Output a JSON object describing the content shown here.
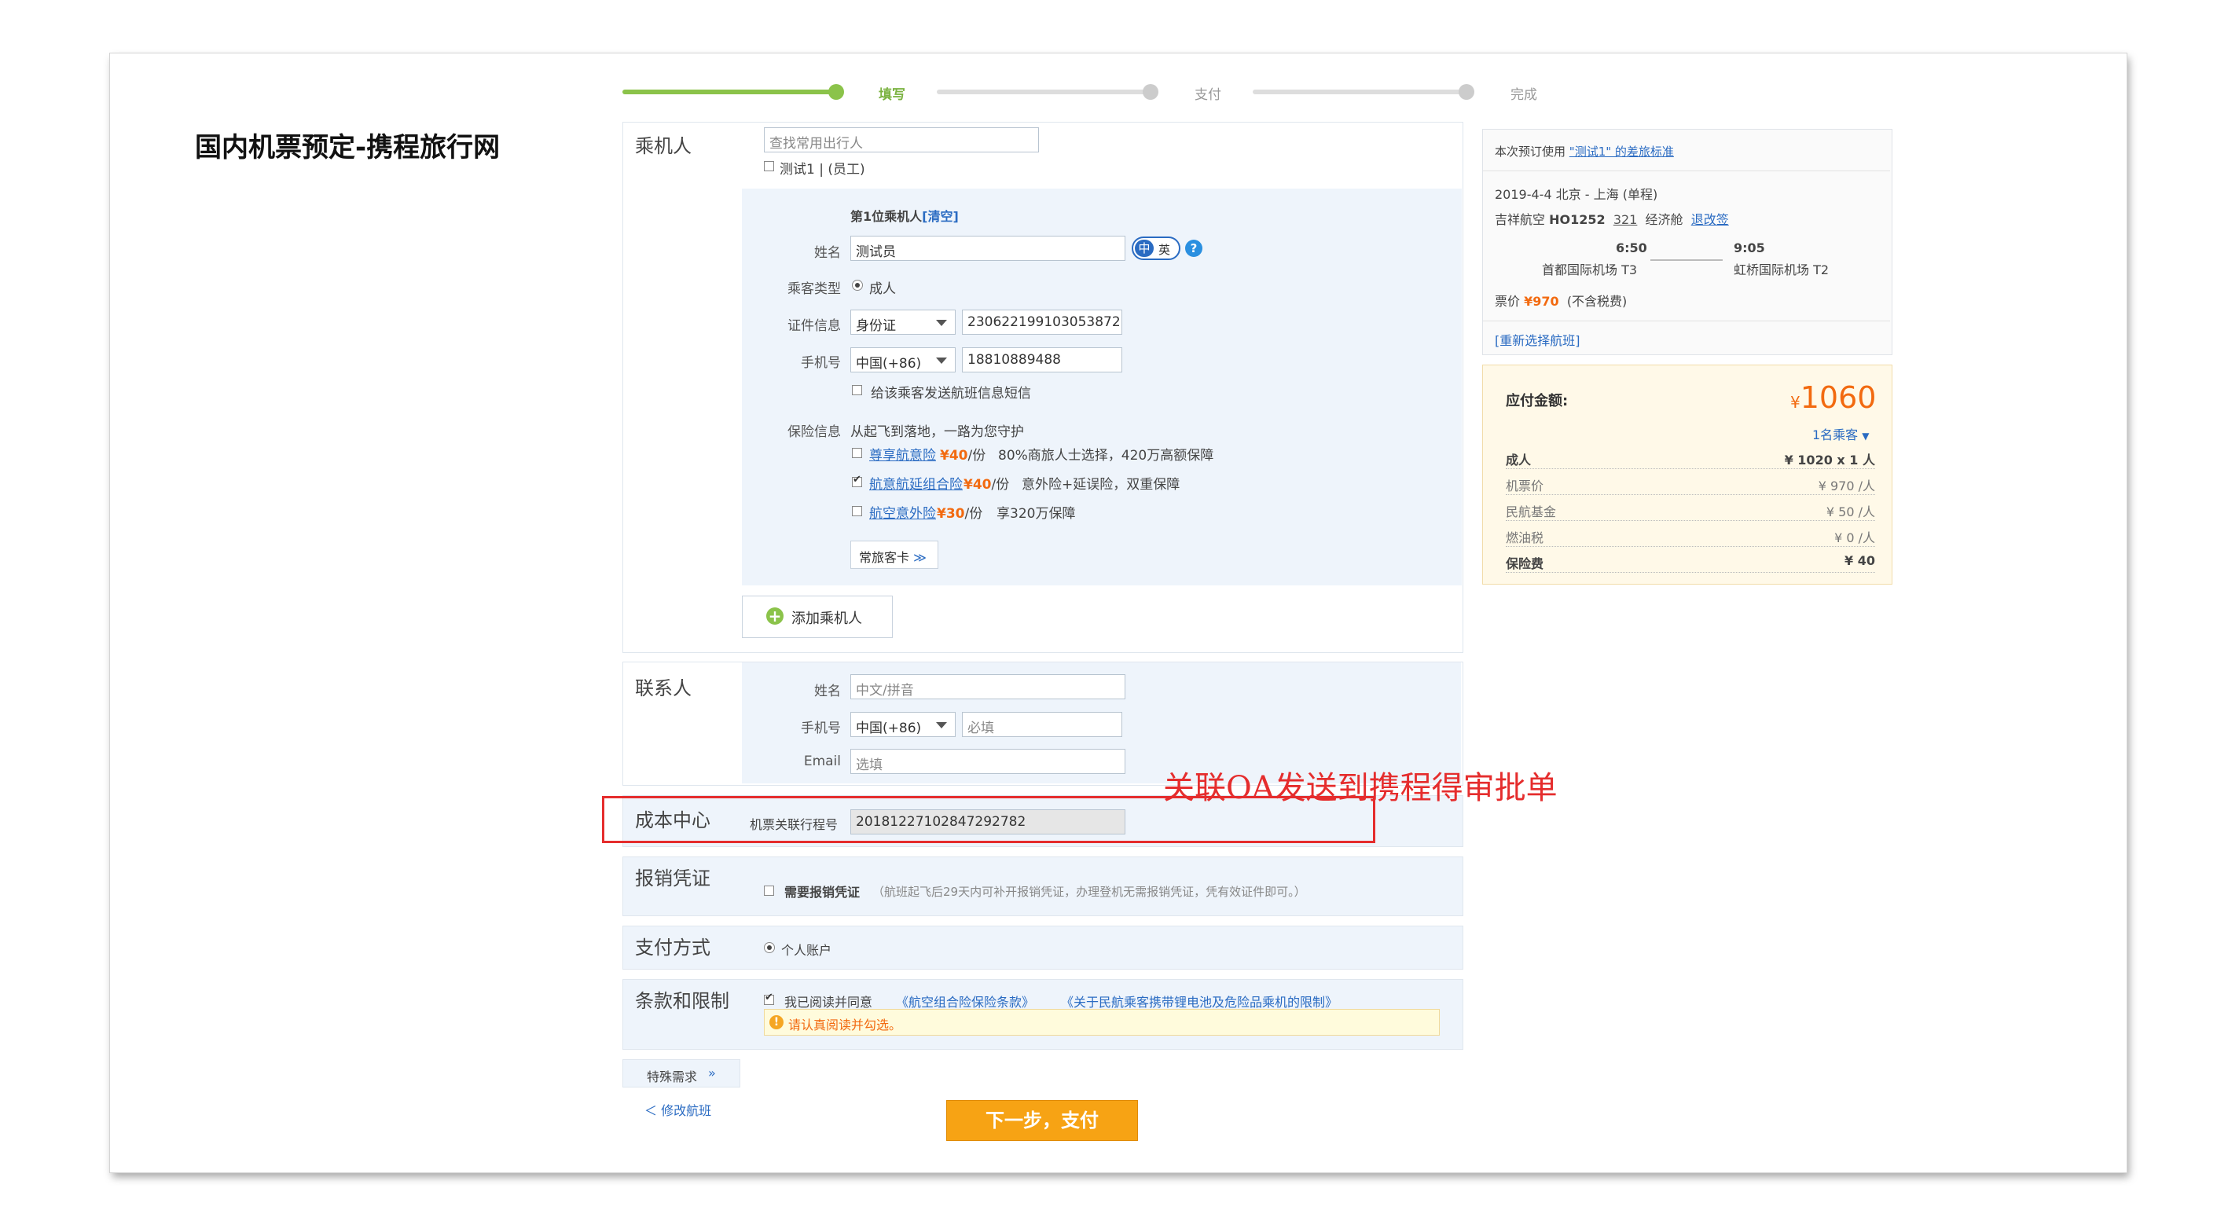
{
  "page_title": "国内机票预定-携程旅行网",
  "progress": {
    "steps": [
      "填写",
      "支付",
      "完成"
    ],
    "current": 0
  },
  "passenger": {
    "section_label": "乘机人",
    "search_placeholder": "查找常用出行人",
    "frequent_option": "测试1 | (员工)",
    "index_label": "第1位乘机人",
    "clear_link": "[清空]",
    "name_label": "姓名",
    "name_value": "测试员",
    "lang_zh": "中",
    "lang_en": "英",
    "help": "?",
    "type_label": "乘客类型",
    "type_value": "成人",
    "id_label": "证件信息",
    "id_type": "身份证",
    "id_number": "230622199103053872",
    "phone_label": "手机号",
    "phone_code": "中国(+86)",
    "phone_number": "18810889488",
    "sms_option": "给该乘客发送航班信息短信",
    "insurance_label": "保险信息",
    "insurance_slogan": "从起飞到落地，一路为您守护",
    "insurance": [
      {
        "name": "尊享航意险",
        "price": "¥40",
        "unit": "/份",
        "desc": "80%商旅人士选择，420万高额保障",
        "checked": false
      },
      {
        "name": "航意航延组合险",
        "price": "¥40",
        "unit": "/份",
        "desc": "意外险+延误险，双重保障",
        "checked": true
      },
      {
        "name": "航空意外险",
        "price": "¥30",
        "unit": "/份",
        "desc": "享320万保障",
        "checked": false
      }
    ],
    "frequent_card_button": "常旅客卡",
    "frequent_card_chevron": "≫",
    "add_button": "添加乘机人",
    "add_icon": "⊕"
  },
  "contact": {
    "section_label": "联系人",
    "name_label": "姓名",
    "name_placeholder": "中文/拼音",
    "phone_label": "手机号",
    "phone_code": "中国(+86)",
    "phone_placeholder": "必填",
    "email_label": "Email",
    "email_placeholder": "选填"
  },
  "cost_center": {
    "section_label": "成本中心",
    "field_label": "机票关联行程号",
    "field_value": "20181227102847292782"
  },
  "reimbursement": {
    "section_label": "报销凭证",
    "option": "需要报销凭证",
    "note": "（航班起飞后29天内可补开报销凭证，办理登机无需报销凭证，凭有效证件即可。）"
  },
  "payment": {
    "section_label": "支付方式",
    "option": "个人账户"
  },
  "terms": {
    "section_label": "条款和限制",
    "agree": "我已阅读并同意",
    "link1": "《航空组合险保险条款》",
    "link2": "《关于民航乘客携带锂电池及危险品乘机的限制》",
    "warning": "请认真阅读并勾选。"
  },
  "special_request": {
    "label": "特殊需求",
    "chevron": "»"
  },
  "modify_flight": "＜ 修改航班",
  "next_button": "下一步，支付",
  "annotation": "关联OA发送到携程得审批单",
  "flight_summary": {
    "policy_prefix": "本次预订使用",
    "policy_link": "\"测试1\" 的差旅标准",
    "route": "2019-4-4 北京 - 上海 (单程)",
    "airline": "吉祥航空",
    "flight_no": "HO1252",
    "aircraft": "321",
    "cabin": "经济舱",
    "refund_link": "退改签",
    "dep_time": "6:50",
    "dep_airport": "首都国际机场 T3",
    "arr_time": "9:05",
    "arr_airport": "虹桥国际机场 T2",
    "price_label": "票价",
    "price": "¥970",
    "price_note": "(不含税费)",
    "reselect_link": "[重新选择航班]"
  },
  "payment_summary": {
    "label": "应付金额:",
    "currency": "¥",
    "total": "1060",
    "passengers_link": "1名乘客",
    "rows": [
      {
        "label": "成人",
        "value": "¥ 1020 x 1 人",
        "bold": true
      },
      {
        "label": "机票价",
        "value": "¥ 970 /人",
        "bold": false
      },
      {
        "label": "民航基金",
        "value": "¥ 50 /人",
        "bold": false
      },
      {
        "label": "燃油税",
        "value": "¥ 0 /人",
        "bold": false
      },
      {
        "label": "保险费",
        "value": "¥ 40",
        "bold": true
      }
    ]
  },
  "colors": {
    "accent_green": "#8bc34a",
    "price_orange": "#f26a10",
    "next_button": "#f7a314",
    "annotation_red": "#e52d2d",
    "link_blue": "#2a6bc2"
  }
}
